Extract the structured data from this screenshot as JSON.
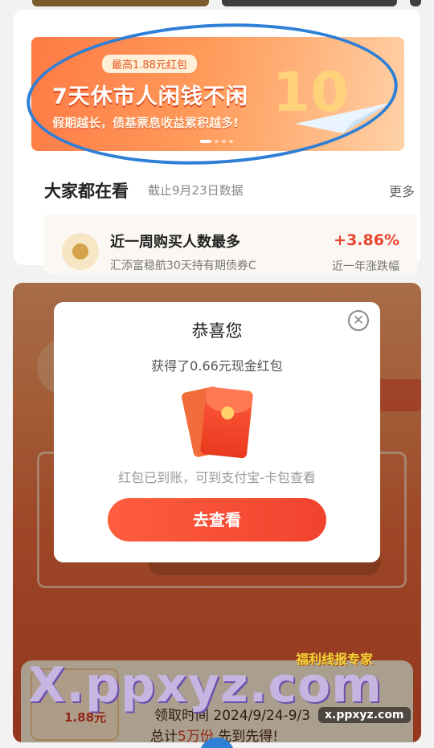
{
  "banner": {
    "badge": "最高1.88元红包",
    "headline": "7天休市人闲钱不闲",
    "subline": "假期越长，债基票息收益累积越多!",
    "big_number": "10"
  },
  "section": {
    "title": "大家都在看",
    "subtitle": "截止9月23日数据",
    "more": "更多"
  },
  "fund": {
    "title": "近一周购买人数最多",
    "name": "汇添富稳航30天持有期债券C",
    "rate": "+3.86%",
    "rate_label": "近一年涨跌幅"
  },
  "activity": {
    "amount": "1.88元",
    "claim_time": "领取时间 2024/9/24-9/3",
    "claim_total_prefix": "总计",
    "claim_total_highlight": "5万份",
    "claim_total_suffix": " 先到先得!"
  },
  "modal": {
    "close_symbol": "✕",
    "title": "恭喜您",
    "amount_text": "获得了0.66元现金红包",
    "note": "红包已到账，可到支付宝-卡包查看",
    "button": "去查看"
  },
  "watermark": {
    "main": "X.ppxyz.com",
    "badge": "福利线报专家",
    "domain": "x.ppxyz.com"
  },
  "colors": {
    "accent_red": "#f0432e",
    "annotation_blue": "#2e7fd6",
    "rate_red": "#e8452f"
  }
}
